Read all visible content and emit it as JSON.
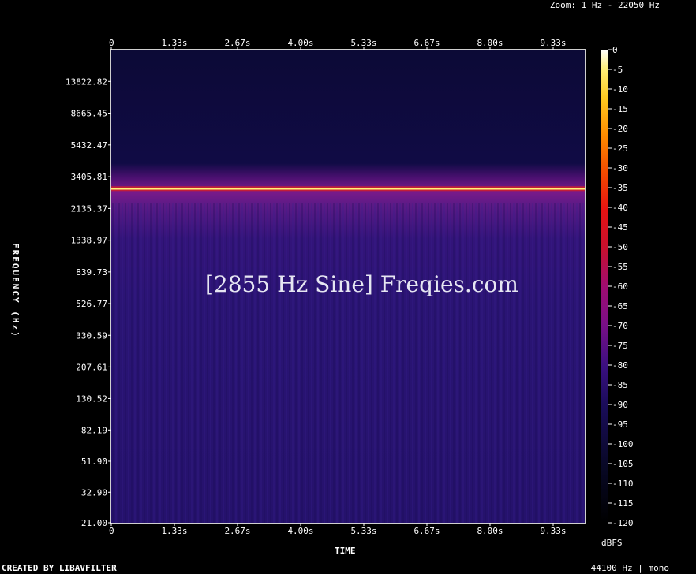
{
  "header": {
    "zoom": "Zoom: 1 Hz - 22050 Hz"
  },
  "footer": {
    "created_by": "CREATED BY LIBAVFILTER",
    "rate": "44100 Hz | mono"
  },
  "watermark": "[2855 Hz Sine] Freqies.com",
  "chart_data": {
    "type": "heatmap",
    "title": "",
    "xlabel": "TIME",
    "ylabel": "FREQUENCY (Hz)",
    "x_ticks": [
      "0",
      "1.33s",
      "2.67s",
      "4.00s",
      "5.33s",
      "6.67s",
      "8.00s",
      "9.33s"
    ],
    "y_ticks": [
      "13822.82",
      "8665.45",
      "5432.47",
      "3405.81",
      "2135.37",
      "1338.97",
      "839.73",
      "526.77",
      "330.59",
      "207.61",
      "130.52",
      "82.19",
      "51.90",
      "32.90",
      "21.00"
    ],
    "y_scale": "log",
    "frequency_range_hz": [
      21,
      22050
    ],
    "duration_s": 10.667,
    "tone_frequency_hz": 2855,
    "tone_level_dbfs": 0,
    "colorbar": {
      "unit": "dBFS",
      "ticks": [
        "0",
        "-5",
        "-10",
        "-15",
        "-20",
        "-25",
        "-30",
        "-35",
        "-40",
        "-45",
        "-50",
        "-55",
        "-60",
        "-65",
        "-70",
        "-75",
        "-80",
        "-85",
        "-90",
        "-95",
        "-100",
        "-105",
        "-110",
        "-115",
        "-120"
      ],
      "range": [
        -120,
        0
      ]
    },
    "colors": {
      "background": "#000000",
      "high_freq_region": "#0d0a3a",
      "low_freq_region": "#2a1475",
      "tone_line": "#fff27a"
    }
  }
}
